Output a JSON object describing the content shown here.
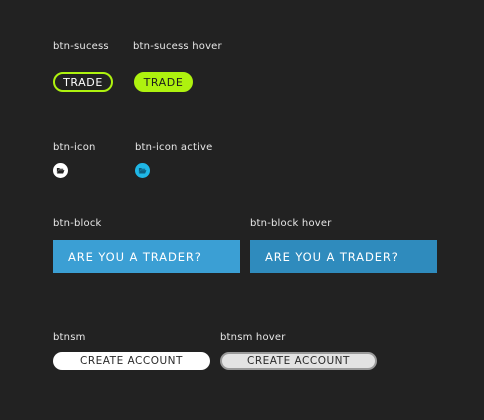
{
  "captions": {
    "btn_success": "btn-sucess",
    "btn_success_hover": "btn-sucess hover",
    "btn_icon": "btn-icon",
    "btn_icon_active": "btn-icon active",
    "btn_block": "btn-block",
    "btn_block_hover": "btn-block hover",
    "btnsm": "btnsm",
    "btnsm_hover": "btnsm hover"
  },
  "buttons": {
    "trade_label": "TRADE",
    "trade_hover_label": "TRADE",
    "block_label": "ARE YOU A TRADER?",
    "block_hover_label": "ARE YOU A TRADER?",
    "create_account_label": "CREATE ACCOUNT",
    "create_account_hover_label": "CREATE ACCOUNT"
  },
  "icons": {
    "btn_icon": "folder-open-icon",
    "btn_icon_active": "folder-open-icon"
  },
  "colors": {
    "background": "#222222",
    "success": "#aef20f",
    "icon_active": "#1fb7e6",
    "block": "#3b9fd4",
    "block_hover": "#2f8bbd"
  }
}
